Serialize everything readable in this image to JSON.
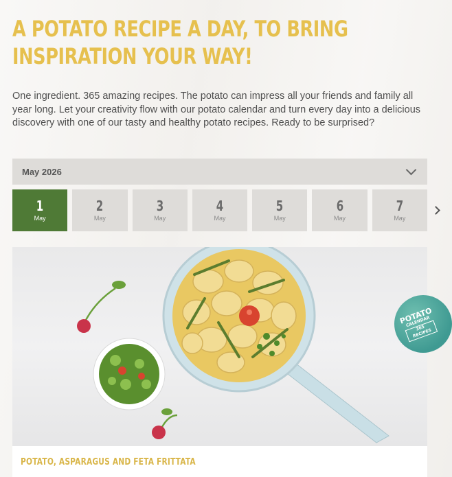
{
  "headline": "A POTATO RECIPE A DAY, TO BRING INSPIRATION YOUR WAY!",
  "intro": "One ingredient. 365 amazing recipes. The potato can impress all your friends and family all year long. Let your creativity flow with our potato calendar and turn every day into a delicious discovery with one of our tasty and healthy potato recipes. Ready to be surprised?",
  "month_select": {
    "value": "May 2026",
    "icon": "chevron-down-icon"
  },
  "days": [
    {
      "num": "1",
      "month": "May",
      "active": true
    },
    {
      "num": "2",
      "month": "May",
      "active": false
    },
    {
      "num": "3",
      "month": "May",
      "active": false
    },
    {
      "num": "4",
      "month": "May",
      "active": false
    },
    {
      "num": "5",
      "month": "May",
      "active": false
    },
    {
      "num": "6",
      "month": "May",
      "active": false
    },
    {
      "num": "7",
      "month": "May",
      "active": false
    }
  ],
  "next_icon": "chevron-right-icon",
  "recipe": {
    "title": "POTATO, ASPARAGUS AND FETA FRITTATA"
  },
  "badge": {
    "line1": "POTATO",
    "line2": "CALENDAR",
    "line3": "365 RECIPES"
  },
  "colors": {
    "accent": "#e6c04e",
    "active_day": "#4f7a36",
    "badge": "#3f9a92"
  }
}
